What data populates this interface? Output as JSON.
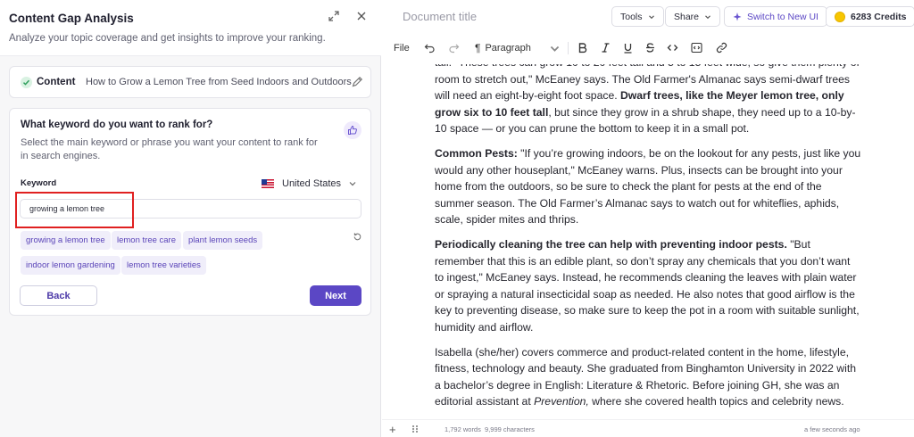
{
  "panel": {
    "title": "Content Gap Analysis",
    "subtitle": "Analyze your topic coverage and get insights to improve your ranking.",
    "icons": [
      "expand-icon",
      "close-icon"
    ]
  },
  "content": {
    "label": "Content",
    "value": "How to Grow a Lemon Tree from Seed Indoors and Outdoors"
  },
  "keyword_step": {
    "question": "What keyword do you want to rank for?",
    "description": "Select the main keyword or phrase you want your content to rank for in search engines.",
    "keyword_label": "Keyword",
    "country": "United States",
    "input_value": "growing a lemon tree",
    "suggestions": [
      "growing a lemon tree",
      "lemon tree care",
      "plant lemon seeds",
      "indoor lemon gardening",
      "lemon tree varieties"
    ],
    "back_label": "Back",
    "next_label": "Next"
  },
  "editor": {
    "doc_title_placeholder": "Document title",
    "tools_label": "Tools",
    "share_label": "Share",
    "switch_label": "Switch to New UI",
    "credits_label": "6283 Credits",
    "menu_file": "File",
    "paragraph_label": "Paragraph",
    "words": "1,792 words",
    "characters": "9,999 characters",
    "saved": "a few seconds ago"
  },
  "document": {
    "p1": {
      "a": "tall. \"These trees can grow 10 to 20 feet tall and 5 to 15 feet wide, so give them plenty of room to stretch out,\" McEaney says. The Old Farmer's Almanac says semi-dwarf trees will need an eight-by-eight foot space. ",
      "b": "Dwarf trees, like the Meyer lemon tree, only grow six to 10 feet tall",
      "c": ", but since they grow in a shrub shape, they need up to a 10-by-10 space — or you can prune the bottom to keep it in a small pot."
    },
    "p2": {
      "a": "Common Pests:",
      "b": " \"If you’re growing indoors, be on the lookout for any pests, just like you would any other houseplant,\" McEaney warns. Plus, insects can be brought into your home from the outdoors, so be sure to check the plant for pests at the end of the summer season. The Old Farmer’s Almanac says to watch out for whiteflies, aphids, scale, spider mites and thrips."
    },
    "p3": {
      "a": "Periodically cleaning the tree can help with preventing indoor pests.",
      "b": " \"But remember that this is an edible plant, so don’t spray any chemicals that you don’t want to ingest,\" McEaney says. Instead, he recommends cleaning the leaves with plain water or spraying a natural insecticidal soap as needed. He also notes that good airflow is the key to preventing disease, so make sure to keep the pot in a room with suitable sunlight, humidity and airflow."
    },
    "p4": {
      "a": "Isabella (she/her) covers commerce and product-related content in the home, lifestyle, fitness, technology and beauty. She graduated from Binghamton University in 2022 with a bachelor’s degree in English: Literature & Rhetoric. Before joining GH, she was an editorial assistant at ",
      "b": "Prevention,",
      "c": " where she covered health topics and celebrity news."
    }
  },
  "colors": {
    "accent": "#5b47c5",
    "chip_bg": "#f0eefa",
    "highlight": "#e02020",
    "credits_coin": "#f7c600"
  }
}
